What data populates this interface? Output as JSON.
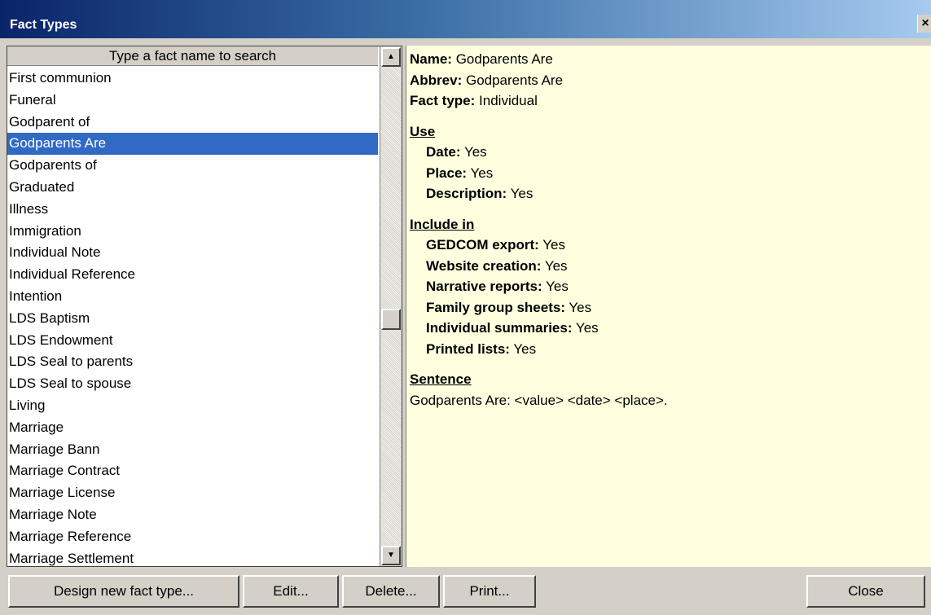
{
  "window": {
    "title": "Fact Types",
    "close_glyph": "×"
  },
  "list": {
    "search_placeholder": "Type a fact name to search",
    "items": [
      "First communion",
      "Funeral",
      "Godparent of",
      "Godparents Are",
      "Godparents of",
      "Graduated",
      "Illness",
      "Immigration",
      "Individual Note",
      "Individual Reference",
      "Intention",
      "LDS Baptism",
      "LDS Endowment",
      "LDS Seal to parents",
      "LDS Seal to spouse",
      "Living",
      "Marriage",
      "Marriage Bann",
      "Marriage Contract",
      "Marriage License",
      "Marriage Note",
      "Marriage Reference",
      "Marriage Settlement"
    ],
    "selected_index": 3
  },
  "detail": {
    "name_label": "Name:",
    "name_value": "Godparents Are",
    "abbrev_label": "Abbrev:",
    "abbrev_value": "Godparents Are",
    "facttype_label": "Fact type:",
    "facttype_value": "Individual",
    "use_heading": "Use",
    "date_label": "Date:",
    "date_value": "Yes",
    "place_label": "Place:",
    "place_value": "Yes",
    "description_label": "Description:",
    "description_value": "Yes",
    "include_heading": "Include in",
    "gedcom_label": "GEDCOM export:",
    "gedcom_value": "Yes",
    "website_label": "Website creation:",
    "website_value": "Yes",
    "narrative_label": "Narrative reports:",
    "narrative_value": "Yes",
    "family_label": "Family group sheets:",
    "family_value": "Yes",
    "summaries_label": "Individual summaries:",
    "summaries_value": "Yes",
    "printed_label": "Printed lists:",
    "printed_value": "Yes",
    "sentence_heading": "Sentence",
    "sentence_value": "Godparents Are: <value> <date> <place>."
  },
  "buttons": {
    "design": "Design new fact type...",
    "edit": "Edit...",
    "delete": "Delete...",
    "print": "Print...",
    "close": "Close"
  },
  "colors": {
    "title_gradient_start": "#0a246a",
    "selection": "#316ac5",
    "detail_background": "#ffffe0",
    "face": "#d4d0c8"
  }
}
